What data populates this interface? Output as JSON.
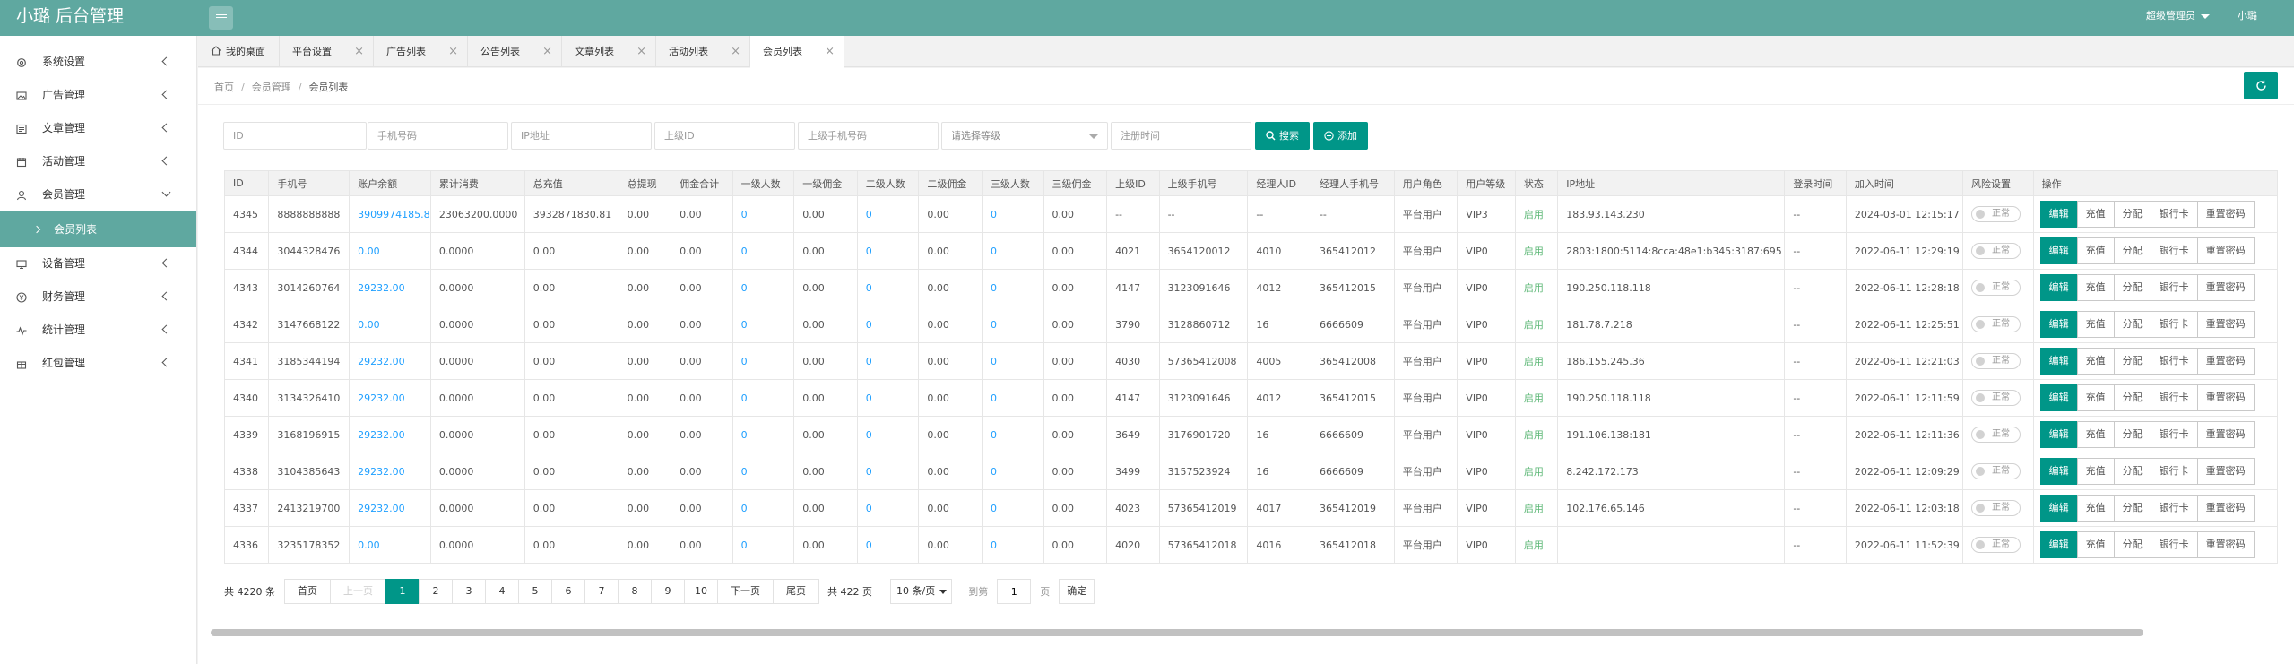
{
  "header": {
    "logo": "小璐 后台管理",
    "user_role": "超级管理员",
    "user_name": "小璐"
  },
  "sidebar": {
    "items": [
      {
        "label": "系统设置",
        "icon": "gear-icon"
      },
      {
        "label": "广告管理",
        "icon": "image-icon"
      },
      {
        "label": "文章管理",
        "icon": "article-icon"
      },
      {
        "label": "活动管理",
        "icon": "calendar-icon"
      },
      {
        "label": "会员管理",
        "icon": "user-icon"
      },
      {
        "label": "设备管理",
        "icon": "device-icon"
      },
      {
        "label": "财务管理",
        "icon": "yen-icon"
      },
      {
        "label": "统计管理",
        "icon": "chart-icon"
      },
      {
        "label": "红包管理",
        "icon": "gift-icon"
      }
    ],
    "sub_item": "会员列表"
  },
  "tabs": [
    "我的桌面",
    "平台设置",
    "广告列表",
    "公告列表",
    "文章列表",
    "活动列表",
    "会员列表"
  ],
  "breadcrumb": [
    "首页",
    "会员管理",
    "会员列表"
  ],
  "filters": {
    "id": "ID",
    "phone": "手机号码",
    "ip": "IP地址",
    "parent_id": "上级ID",
    "parent_phone": "上级手机号码",
    "level": "请选择等级",
    "reg_time": "注册时间",
    "search": "搜索",
    "add": "添加"
  },
  "table": {
    "headers": [
      "ID",
      "手机号",
      "账户余额",
      "累计消费",
      "总充值",
      "总提现",
      "佣金合计",
      "一级人数",
      "一级佣金",
      "二级人数",
      "二级佣金",
      "三级人数",
      "三级佣金",
      "上级ID",
      "上级手机号",
      "经理人ID",
      "经理人手机号",
      "用户角色",
      "用户等级",
      "状态",
      "IP地址",
      "登录时间",
      "加入时间",
      "风险设置",
      "操作"
    ],
    "rows": [
      [
        "4345",
        "8888888888",
        "3909974185.81",
        "23063200.0000",
        "3932871830.81",
        "0.00",
        "0.00",
        "0",
        "0.00",
        "0",
        "0.00",
        "0",
        "0.00",
        "--",
        "--",
        "--",
        "--",
        "平台用户",
        "VIP3",
        "启用",
        "183.93.143.230",
        "--",
        "2024-03-01 12:15:17"
      ],
      [
        "4344",
        "3044328476",
        "0.00",
        "0.0000",
        "0.00",
        "0.00",
        "0.00",
        "0",
        "0.00",
        "0",
        "0.00",
        "0",
        "0.00",
        "4021",
        "3654120012",
        "4010",
        "365412012",
        "平台用户",
        "VIP0",
        "启用",
        "2803:1800:5114:8cca:48e1:b345:3187:695",
        "--",
        "2022-06-11 12:29:19"
      ],
      [
        "4343",
        "3014260764",
        "29232.00",
        "0.0000",
        "0.00",
        "0.00",
        "0.00",
        "0",
        "0.00",
        "0",
        "0.00",
        "0",
        "0.00",
        "4147",
        "3123091646",
        "4012",
        "365412015",
        "平台用户",
        "VIP0",
        "启用",
        "190.250.118.118",
        "--",
        "2022-06-11 12:28:18"
      ],
      [
        "4342",
        "3147668122",
        "0.00",
        "0.0000",
        "0.00",
        "0.00",
        "0.00",
        "0",
        "0.00",
        "0",
        "0.00",
        "0",
        "0.00",
        "3790",
        "3128860712",
        "16",
        "6666609",
        "平台用户",
        "VIP0",
        "启用",
        "181.78.7.218",
        "--",
        "2022-06-11 12:25:51"
      ],
      [
        "4341",
        "3185344194",
        "29232.00",
        "0.0000",
        "0.00",
        "0.00",
        "0.00",
        "0",
        "0.00",
        "0",
        "0.00",
        "0",
        "0.00",
        "4030",
        "57365412008",
        "4005",
        "365412008",
        "平台用户",
        "VIP0",
        "启用",
        "186.155.245.36",
        "--",
        "2022-06-11 12:21:03"
      ],
      [
        "4340",
        "3134326410",
        "29232.00",
        "0.0000",
        "0.00",
        "0.00",
        "0.00",
        "0",
        "0.00",
        "0",
        "0.00",
        "0",
        "0.00",
        "4147",
        "3123091646",
        "4012",
        "365412015",
        "平台用户",
        "VIP0",
        "启用",
        "190.250.118.118",
        "--",
        "2022-06-11 12:11:59"
      ],
      [
        "4339",
        "3168196915",
        "29232.00",
        "0.0000",
        "0.00",
        "0.00",
        "0.00",
        "0",
        "0.00",
        "0",
        "0.00",
        "0",
        "0.00",
        "3649",
        "3176901720",
        "16",
        "6666609",
        "平台用户",
        "VIP0",
        "启用",
        "191.106.138:181",
        "--",
        "2022-06-11 12:11:36"
      ],
      [
        "4338",
        "3104385643",
        "29232.00",
        "0.0000",
        "0.00",
        "0.00",
        "0.00",
        "0",
        "0.00",
        "0",
        "0.00",
        "0",
        "0.00",
        "3499",
        "3157523924",
        "16",
        "6666609",
        "平台用户",
        "VIP0",
        "启用",
        "8.242.172.173",
        "--",
        "2022-06-11 12:09:29"
      ],
      [
        "4337",
        "2413219700",
        "29232.00",
        "0.0000",
        "0.00",
        "0.00",
        "0.00",
        "0",
        "0.00",
        "0",
        "0.00",
        "0",
        "0.00",
        "4023",
        "57365412019",
        "4017",
        "365412019",
        "平台用户",
        "VIP0",
        "启用",
        "102.176.65.146",
        "--",
        "2022-06-11 12:03:18"
      ],
      [
        "4336",
        "3235178352",
        "0.00",
        "0.0000",
        "0.00",
        "0.00",
        "0.00",
        "0",
        "0.00",
        "0",
        "0.00",
        "0",
        "0.00",
        "4020",
        "57365412018",
        "4016",
        "365412018",
        "平台用户",
        "VIP0",
        "启用",
        "",
        "--",
        "2022-06-11 11:52:39"
      ]
    ],
    "risk_label": "正常",
    "ops": [
      "编辑",
      "充值",
      "分配",
      "银行卡",
      "重置密码"
    ]
  },
  "pager": {
    "total": "共 4220 条",
    "first": "首页",
    "prev": "上一页",
    "pages": [
      "1",
      "2",
      "3",
      "4",
      "5",
      "6",
      "7",
      "8",
      "9",
      "10"
    ],
    "next": "下一页",
    "last": "尾页",
    "total_pages": "共 422 页",
    "per_page": "10 条/页",
    "goto": "到第",
    "goto_value": "1",
    "page_unit": "页",
    "confirm": "确定"
  },
  "colors": {
    "header": "#5fa8a0",
    "primary": "#009688",
    "link": "#1e9fff",
    "status": "#5fb878"
  }
}
